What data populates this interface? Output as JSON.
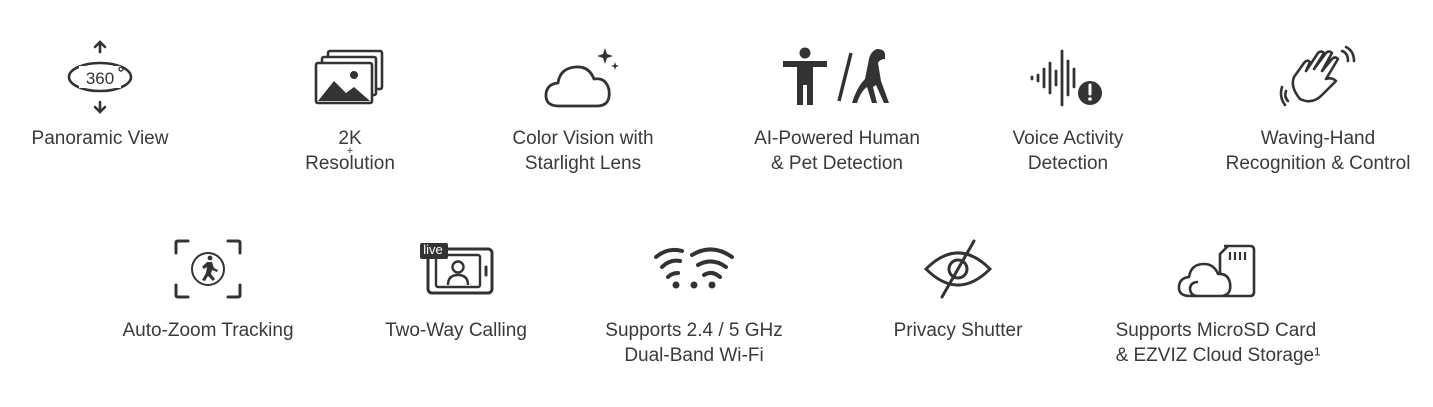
{
  "row1": [
    {
      "id": "panoramic-view",
      "icon": "rotate-360-icon",
      "lines": [
        "Panoramic View"
      ]
    },
    {
      "id": "2k-resolution",
      "icon": "image-stack-icon",
      "lines_prefix": "2K",
      "lines_sup": "+",
      "lines_suffix": " Resolution"
    },
    {
      "id": "color-vision",
      "icon": "cloud-sparkle-icon",
      "lines": [
        "Color Vision with",
        "Starlight Lens"
      ]
    },
    {
      "id": "ai-detection",
      "icon": "human-pet-icon",
      "lines": [
        "AI-Powered Human",
        "& Pet Detection"
      ]
    },
    {
      "id": "voice-activity",
      "icon": "sound-alert-icon",
      "lines": [
        "Voice Activity",
        "Detection"
      ]
    },
    {
      "id": "waving-hand",
      "icon": "waving-hand-icon",
      "lines": [
        "Waving-Hand",
        "Recognition & Control"
      ]
    }
  ],
  "row2": [
    {
      "id": "auto-zoom",
      "icon": "tracking-frame-icon",
      "lines": [
        "Auto-Zoom Tracking"
      ]
    },
    {
      "id": "two-way-calling",
      "icon": "live-call-icon",
      "icon_badge": "live",
      "lines": [
        "Two-Way Calling"
      ]
    },
    {
      "id": "dual-band-wifi",
      "icon": "wifi-icon",
      "lines": [
        "Supports 2.4 / 5 GHz",
        "Dual-Band Wi-Fi"
      ]
    },
    {
      "id": "privacy-shutter",
      "icon": "eye-slash-icon",
      "lines": [
        "Privacy Shutter"
      ]
    },
    {
      "id": "storage",
      "icon": "cloud-sdcard-icon",
      "lines": [
        "Supports MicroSD Card",
        "& EZVIZ Cloud Storage¹"
      ]
    }
  ],
  "colors": {
    "icon": "#333333",
    "text": "#3a3a3a",
    "background": "#ffffff"
  }
}
